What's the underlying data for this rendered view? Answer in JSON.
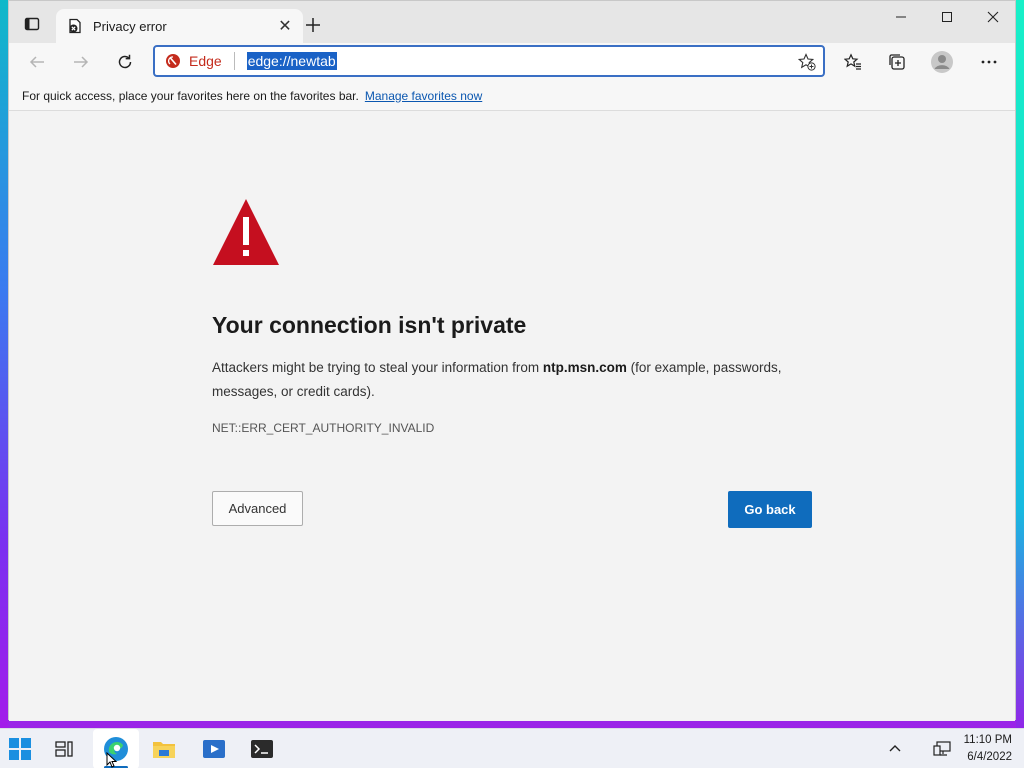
{
  "browser": {
    "tab": {
      "title": "Privacy error"
    },
    "site_chip_label": "Edge",
    "url": "edge://newtab"
  },
  "favorites_bar": {
    "text": "For quick access, place your favorites here on the favorites bar.",
    "link": "Manage favorites now"
  },
  "error_page": {
    "title": "Your connection isn't private",
    "desc_prefix": "Attackers might be trying to steal your information from ",
    "desc_host": "ntp.msn.com",
    "desc_suffix": " (for example, passwords, messages, or credit cards).",
    "code": "NET::ERR_CERT_AUTHORITY_INVALID",
    "advanced_label": "Advanced",
    "goback_label": "Go back"
  },
  "taskbar": {
    "time": "11:10 PM",
    "date": "6/4/2022"
  },
  "colors": {
    "accent": "#0f6cbd",
    "warning_red": "#c50f1f",
    "edge_red": "#c42b1c"
  }
}
